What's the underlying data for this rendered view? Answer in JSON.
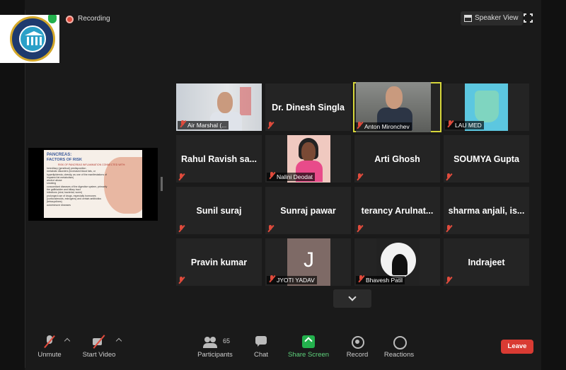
{
  "topbar": {
    "recording_label": "Recording",
    "speaker_view_label": "Speaker View"
  },
  "gallery": {
    "tiles": [
      {
        "name": "Air Marshal (...",
        "has_video": true
      },
      {
        "name": "Dr. Dinesh Singla",
        "has_video": false
      },
      {
        "name": "Anton Mironchev",
        "has_video": true,
        "active": true
      },
      {
        "name": "LAU MED",
        "has_video": true
      },
      {
        "name": "Rahul Ravish sa...",
        "has_video": false
      },
      {
        "name": "Nalini Deodat",
        "has_video": true
      },
      {
        "name": "Arti Ghosh",
        "has_video": false
      },
      {
        "name": "SOUMYA Gupta",
        "has_video": false
      },
      {
        "name": "Sunil suraj",
        "has_video": false
      },
      {
        "name": "Sunraj pawar",
        "has_video": false
      },
      {
        "name": "terancy Arulnat...",
        "has_video": false
      },
      {
        "name": "sharma anjali, is...",
        "has_video": false
      },
      {
        "name": "Pravin kumar",
        "has_video": false
      },
      {
        "name": "JYOTI YADAV",
        "has_video": true,
        "avatar_letter": "J"
      },
      {
        "name": "Bhavesh Patil",
        "has_video": true
      },
      {
        "name": "Indrajeet",
        "has_video": false
      }
    ]
  },
  "shared_slide": {
    "title_line1": "PANCREAS:",
    "title_line2": "FACTORS OF RISK",
    "subtitle": "RISK OF PANCREAS INFLAMMATION CONNECTED WITH:",
    "bullets": [
      "hereditary (genetical) predisposition",
      "metabolic disorders (increased blood fats, or hyperlipidemia, obesity, as one of the manifestations of impaired fat metabolism)",
      "alcohol abuse",
      "smoking",
      "concomitant diseases of the digestive system, primarily the gallbladder and biliary tract",
      "infections (viral, bacterial, worm)",
      "prolonged use of drugs, especially hormones (corticosteroids, estrogens) and certain antibiotics (tetracyclines)",
      "autoimmune diseases"
    ]
  },
  "toolbar": {
    "unmute_label": "Unmute",
    "start_video_label": "Start Video",
    "participants_label": "Participants",
    "participants_count": "65",
    "chat_label": "Chat",
    "share_screen_label": "Share Screen",
    "record_label": "Record",
    "reactions_label": "Reactions",
    "leave_label": "Leave"
  },
  "colors": {
    "share_screen_green": "#23b14d",
    "leave_red": "#d93b33",
    "active_speaker": "#d6d63a",
    "muted_red": "#e04b3c"
  }
}
